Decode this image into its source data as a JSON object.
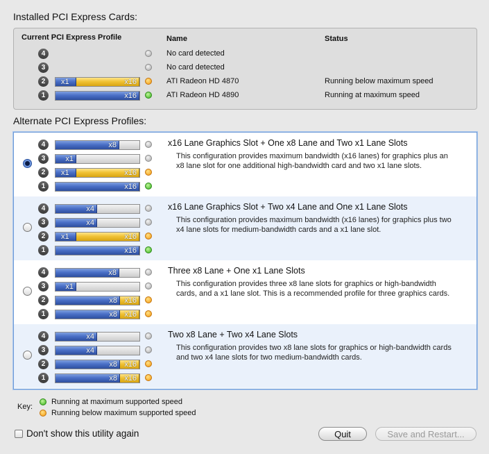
{
  "installed": {
    "heading": "Installed PCI Express Cards:",
    "columns": {
      "profile": "Current PCI Express Profile",
      "name": "Name",
      "status": "Status"
    },
    "rows": [
      {
        "slot": "4",
        "name": "No card detected",
        "status": "",
        "light": "gray",
        "bar": []
      },
      {
        "slot": "3",
        "name": "No card detected",
        "status": "",
        "light": "gray",
        "bar": []
      },
      {
        "slot": "2",
        "name": "ATI Radeon HD 4870",
        "status": "Running below maximum speed",
        "light": "orange",
        "bar": [
          {
            "label": "x1",
            "color": "blue",
            "lanes": 1
          },
          {
            "label": "x16",
            "color": "yellow",
            "lanes": 16
          }
        ]
      },
      {
        "slot": "1",
        "name": "ATI Radeon HD 4890",
        "status": "Running at maximum speed",
        "light": "green",
        "bar": [
          {
            "label": "x16",
            "color": "blue",
            "lanes": 16
          }
        ]
      }
    ]
  },
  "alternate": {
    "heading": "Alternate PCI Express Profiles:",
    "profiles": [
      {
        "selected": true,
        "title": "x16 Lane Graphics Slot + One x8 Lane and Two x1 Lane Slots",
        "description": "This configuration provides maximum bandwidth (x16 lanes) for graphics plus an x8 lane slot for one additional high-bandwidth card and two x1 lane slots.",
        "slots": [
          {
            "slot": "4",
            "light": "gray",
            "bar": [
              {
                "label": "x8",
                "color": "blue",
                "lanes": 8
              }
            ]
          },
          {
            "slot": "3",
            "light": "gray",
            "bar": [
              {
                "label": "x1",
                "color": "blue",
                "lanes": 1
              }
            ]
          },
          {
            "slot": "2",
            "light": "orange",
            "bar": [
              {
                "label": "x1",
                "color": "blue",
                "lanes": 1
              },
              {
                "label": "x16",
                "color": "yellow",
                "lanes": 16
              }
            ]
          },
          {
            "slot": "1",
            "light": "green",
            "bar": [
              {
                "label": "x16",
                "color": "blue",
                "lanes": 16
              }
            ]
          }
        ]
      },
      {
        "selected": false,
        "title": "x16 Lane Graphics Slot + Two x4 Lane and One x1 Lane Slots",
        "description": "This configuration provides maximum bandwidth (x16 lanes) for graphics plus two x4 lane slots for medium-bandwidth cards and a x1 lane slot.",
        "slots": [
          {
            "slot": "4",
            "light": "gray",
            "bar": [
              {
                "label": "x4",
                "color": "blue",
                "lanes": 4
              }
            ]
          },
          {
            "slot": "3",
            "light": "gray",
            "bar": [
              {
                "label": "x4",
                "color": "blue",
                "lanes": 4
              }
            ]
          },
          {
            "slot": "2",
            "light": "orange",
            "bar": [
              {
                "label": "x1",
                "color": "blue",
                "lanes": 1
              },
              {
                "label": "x16",
                "color": "yellow",
                "lanes": 16
              }
            ]
          },
          {
            "slot": "1",
            "light": "green",
            "bar": [
              {
                "label": "x16",
                "color": "blue",
                "lanes": 16
              }
            ]
          }
        ]
      },
      {
        "selected": false,
        "title": "Three x8 Lane + One x1 Lane Slots",
        "description": "This configuration provides three x8 lane slots for graphics or high-bandwidth cards, and a x1 lane slot.  This is a recommended profile for three graphics cards.",
        "slots": [
          {
            "slot": "4",
            "light": "gray",
            "bar": [
              {
                "label": "x8",
                "color": "blue",
                "lanes": 8
              }
            ]
          },
          {
            "slot": "3",
            "light": "gray",
            "bar": [
              {
                "label": "x1",
                "color": "blue",
                "lanes": 1
              }
            ]
          },
          {
            "slot": "2",
            "light": "orange",
            "bar": [
              {
                "label": "x8",
                "color": "blue",
                "lanes": 8
              },
              {
                "label": "x16",
                "color": "yellow",
                "lanes": 16
              }
            ]
          },
          {
            "slot": "1",
            "light": "orange",
            "bar": [
              {
                "label": "x8",
                "color": "blue",
                "lanes": 8
              },
              {
                "label": "x16",
                "color": "yellow",
                "lanes": 16
              }
            ]
          }
        ]
      },
      {
        "selected": false,
        "title": "Two x8 Lane + Two x4 Lane Slots",
        "description": "This configuration provides two x8 lane slots for graphics or high-bandwidth cards and two x4 lane slots for two medium-bandwidth cards.",
        "slots": [
          {
            "slot": "4",
            "light": "gray",
            "bar": [
              {
                "label": "x4",
                "color": "blue",
                "lanes": 4
              }
            ]
          },
          {
            "slot": "3",
            "light": "gray",
            "bar": [
              {
                "label": "x4",
                "color": "blue",
                "lanes": 4
              }
            ]
          },
          {
            "slot": "2",
            "light": "orange",
            "bar": [
              {
                "label": "x8",
                "color": "blue",
                "lanes": 8
              },
              {
                "label": "x16",
                "color": "yellow",
                "lanes": 16
              }
            ]
          },
          {
            "slot": "1",
            "light": "orange",
            "bar": [
              {
                "label": "x8",
                "color": "blue",
                "lanes": 8
              },
              {
                "label": "x16",
                "color": "yellow",
                "lanes": 16
              }
            ]
          }
        ]
      }
    ]
  },
  "key": {
    "label": "Key:",
    "green": "Running at maximum supported speed",
    "orange": "Running below maximum supported speed"
  },
  "footer": {
    "dont_show_label": "Don't show this utility again",
    "dont_show_checked": false,
    "quit_label": "Quit",
    "save_label": "Save and Restart..."
  },
  "colors": {
    "lane_blue": "#4a6fc7",
    "lane_yellow": "#f0c235",
    "light_green": "#39b21d",
    "light_orange": "#f49a10",
    "selection_border": "#6e9bd6"
  }
}
